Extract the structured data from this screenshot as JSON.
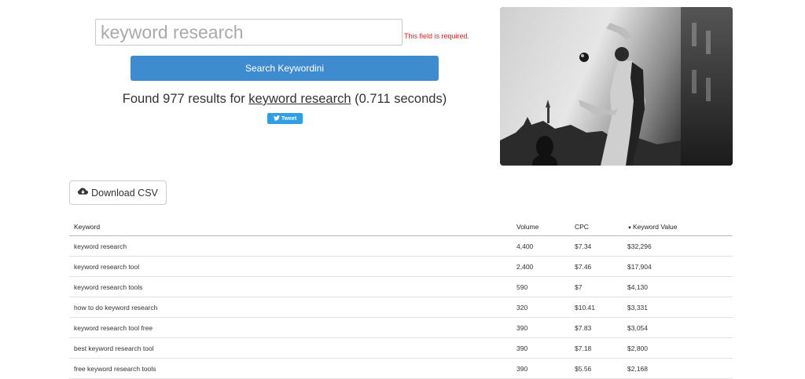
{
  "search": {
    "placeholder": "keyword research",
    "error": "This field is required.",
    "button_label": "Search Keywordini"
  },
  "results_summary": {
    "prefix": "Found 977 results for ",
    "query": "keyword research",
    "suffix": " (0.711 seconds)"
  },
  "tweet": {
    "label": "Tweet"
  },
  "download": {
    "label": "Download CSV"
  },
  "table": {
    "headers": {
      "keyword": "Keyword",
      "volume": "Volume",
      "cpc": "CPC",
      "value": "Keyword Value"
    },
    "rows": [
      {
        "keyword": "keyword research",
        "volume": "4,400",
        "cpc": "$7.34",
        "value": "$32,296"
      },
      {
        "keyword": "keyword research tool",
        "volume": "2,400",
        "cpc": "$7.46",
        "value": "$17,904"
      },
      {
        "keyword": "keyword research tools",
        "volume": "590",
        "cpc": "$7",
        "value": "$4,130"
      },
      {
        "keyword": "how to do keyword research",
        "volume": "320",
        "cpc": "$10.41",
        "value": "$3,331"
      },
      {
        "keyword": "keyword research tool free",
        "volume": "390",
        "cpc": "$7.83",
        "value": "$3,054"
      },
      {
        "keyword": "best keyword research tool",
        "volume": "390",
        "cpc": "$7.18",
        "value": "$2,800"
      },
      {
        "keyword": "free keyword research tools",
        "volume": "390",
        "cpc": "$5.56",
        "value": "$2,168"
      }
    ]
  }
}
